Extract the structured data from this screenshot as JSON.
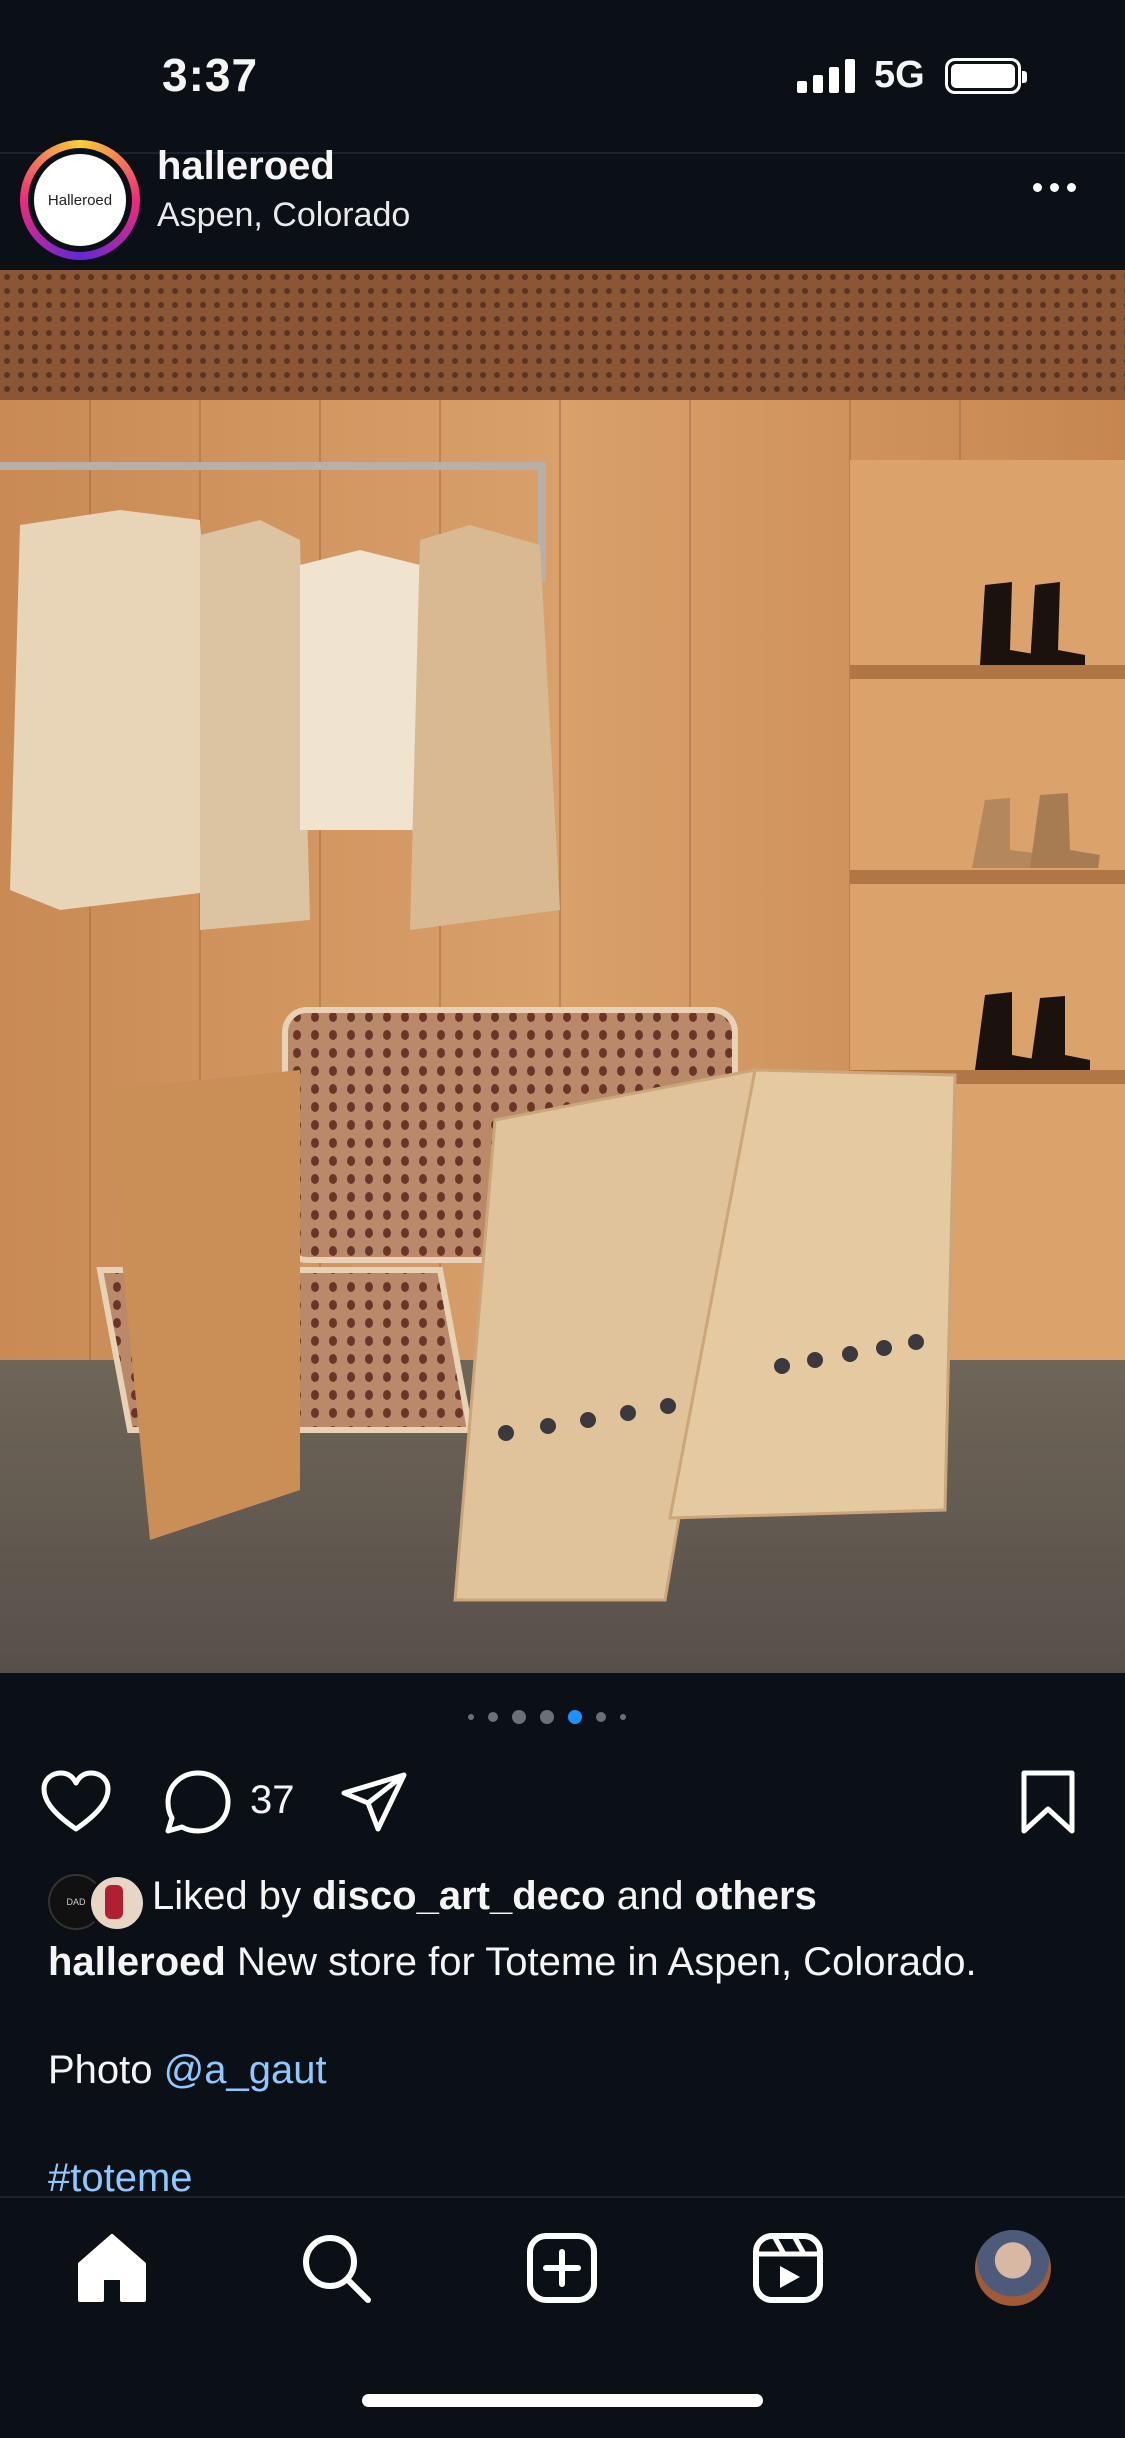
{
  "status_bar": {
    "time": "3:37",
    "network": "5G"
  },
  "post": {
    "avatar_text": "Halleroed",
    "username": "halleroed",
    "location": "Aspen, Colorado",
    "carousel": {
      "count": 7,
      "active_index": 4
    },
    "comment_count": "37",
    "liked_by": {
      "prefix": "Liked by",
      "user": "disco_art_deco",
      "middle": "and",
      "others": "others",
      "avatar_1_text": "DAD"
    },
    "caption": {
      "username": "halleroed",
      "text": "New store for Toteme in Aspen, Colorado."
    },
    "photo_credit": {
      "label": "Photo",
      "handle": "@a_gaut"
    },
    "hashtag": "#toteme"
  },
  "colors": {
    "background": "#0b0f16",
    "accent_link": "#8fc7ff",
    "carousel_active": "#1e90ff"
  },
  "icons": {
    "like": "heart-icon",
    "comment": "comment-icon",
    "share": "send-icon",
    "save": "bookmark-icon",
    "more": "more-dots-icon",
    "nav": [
      "home-icon",
      "search-icon",
      "create-icon",
      "reels-icon",
      "profile-avatar"
    ]
  }
}
